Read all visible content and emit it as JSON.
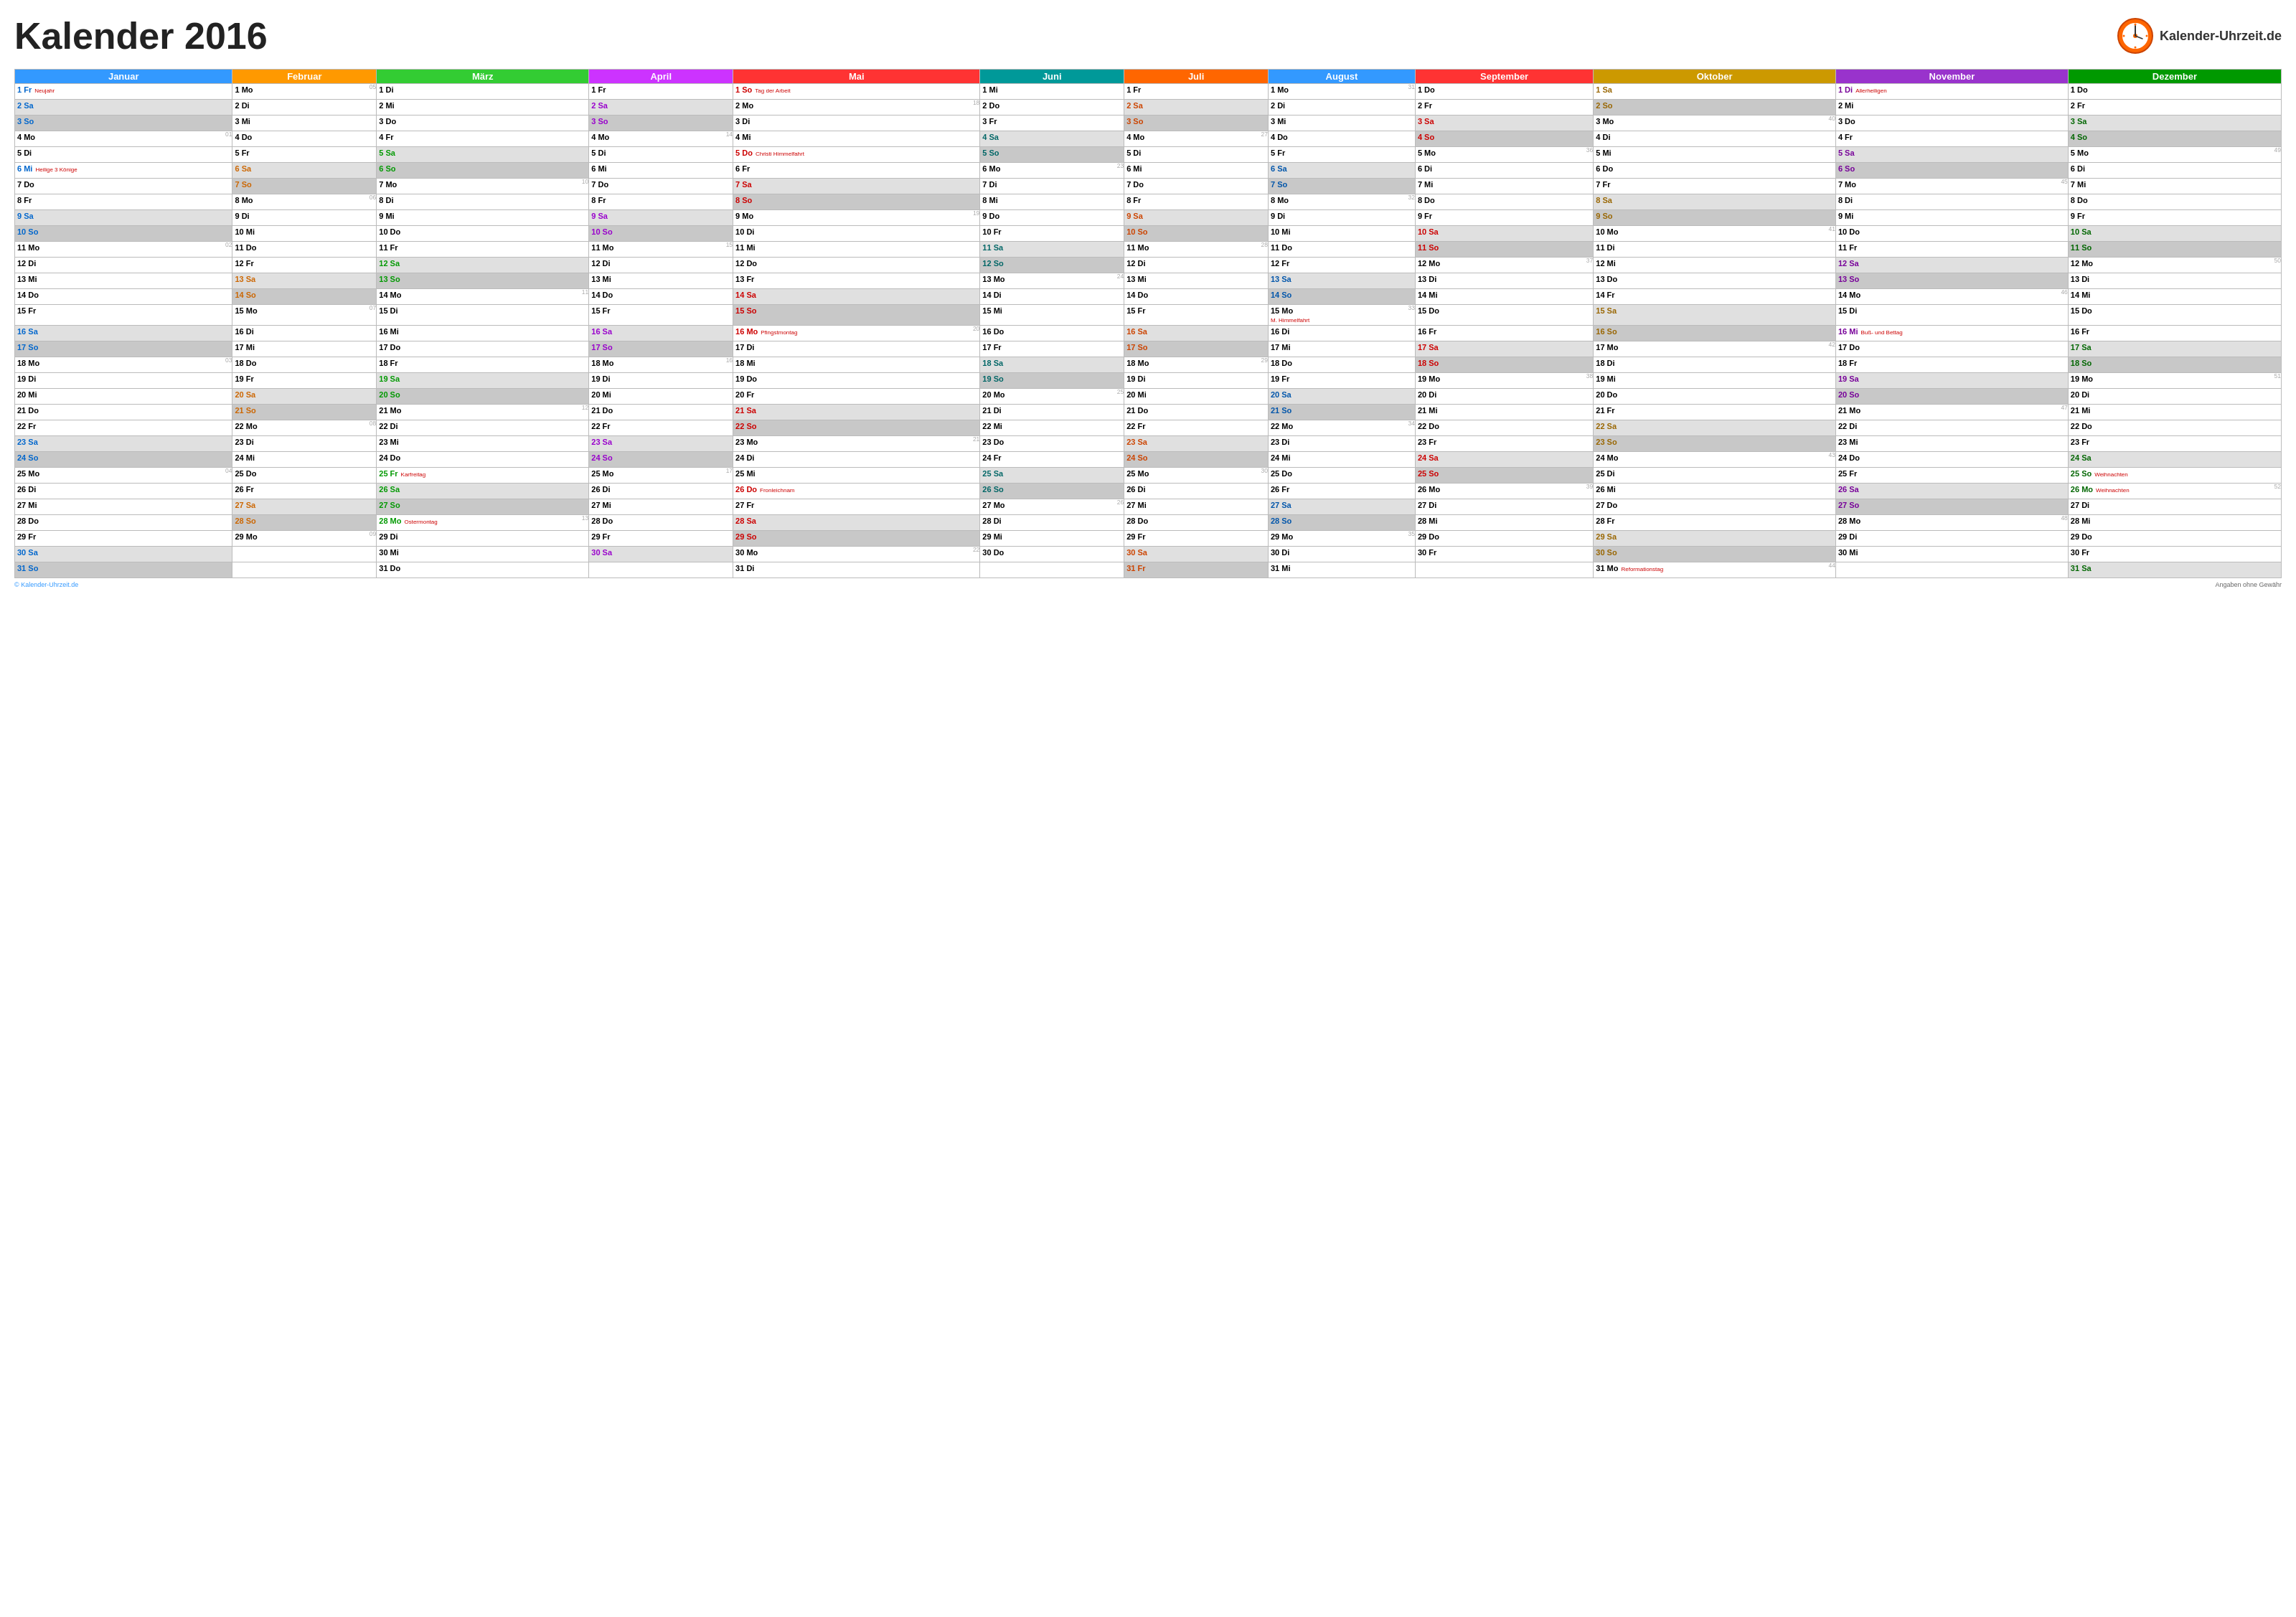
{
  "title": "Kalender 2016",
  "logo_text": "Kalender-Uhrzeit.de",
  "footer_left": "© Kalender-Uhrzeit.de",
  "footer_right": "Angaben ohne Gewähr",
  "months": [
    {
      "name": "Januar",
      "class": "jan-header",
      "dayclass": "jan-day"
    },
    {
      "name": "Februar",
      "class": "feb-header",
      "dayclass": "feb-day"
    },
    {
      "name": "März",
      "class": "mar-header",
      "dayclass": "mar-day"
    },
    {
      "name": "April",
      "class": "apr-header",
      "dayclass": "apr-day"
    },
    {
      "name": "Mai",
      "class": "mai-header",
      "dayclass": "mai-day"
    },
    {
      "name": "Juni",
      "class": "jun-header",
      "dayclass": "jun-day"
    },
    {
      "name": "Juli",
      "class": "jul-header",
      "dayclass": "jul-day"
    },
    {
      "name": "August",
      "class": "aug-header",
      "dayclass": "aug-day"
    },
    {
      "name": "September",
      "class": "sep-header",
      "dayclass": "sep-day"
    },
    {
      "name": "Oktober",
      "class": "okt-header",
      "dayclass": "okt-day"
    },
    {
      "name": "November",
      "class": "nov-header",
      "dayclass": "nov-day"
    },
    {
      "name": "Dezember",
      "class": "dez-header",
      "dayclass": "dez-day"
    }
  ]
}
